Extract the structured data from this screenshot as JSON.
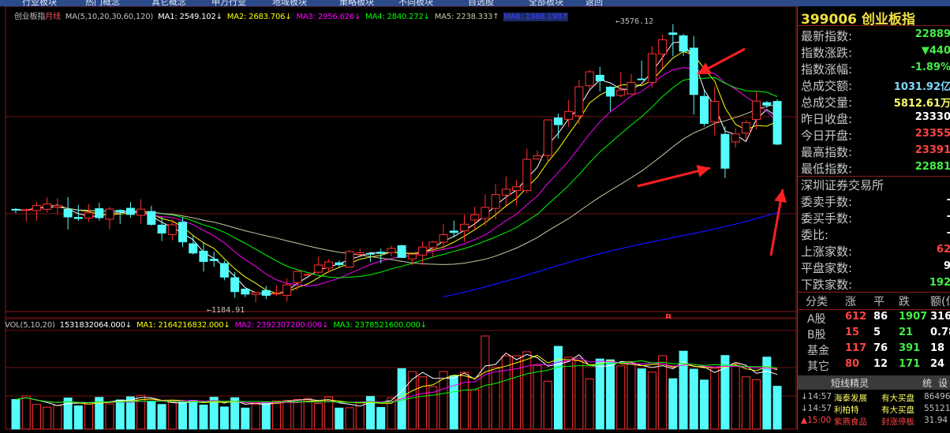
{
  "top_tabs": [
    "行业板块",
    "热门概念",
    "其它概念",
    "申万行业",
    "地域板块",
    "策略板块",
    "不同板块",
    "自选股",
    "全部板块",
    "返回"
  ],
  "main_legend": {
    "name": "创业板指",
    "period": "月线",
    "ma_params": "MA(5,10,20,30,60,120)",
    "ma1": "MA1: 2549.102↓",
    "ma2": "MA2: 2683.706↓",
    "ma3": "MA3: 2956.626↓",
    "ma4": "MA4: 2840.272↓",
    "ma5": "MA5: 2238.333↑",
    "ma6": "MA6: 1986.198↑"
  },
  "high_label": "3576.12",
  "low_label": "1184.91",
  "b_marker": "B",
  "vol_legend": {
    "params": "VOL(5,10,20)",
    "vol": "1531832064.000↓",
    "ma1": "MA1: 2164216832.000↓",
    "ma2": "MA2: 2392307200.000↓",
    "ma3": "MA3: 2378521600.000↓"
  },
  "colors": {
    "up": "#ff3030",
    "down": "#54fcfc",
    "ma1": "#ffffff",
    "ma2": "#ffff00",
    "ma3": "#ff00ff",
    "ma4": "#00ff00",
    "ma5": "#c8c8a0",
    "ma6": "#1010ff",
    "arrow": "#ff2020"
  },
  "panel": {
    "code": "399006",
    "title": "创业板指",
    "rows": [
      {
        "label": "最新指数:",
        "value": "22889",
        "color": "green"
      },
      {
        "label": "指数涨跌:",
        "value": "▼440",
        "color": "green"
      },
      {
        "label": "指数涨幅:",
        "value": "-1.89%",
        "color": "green"
      },
      {
        "label": "总成交额:",
        "value": "1031.92亿",
        "color": "cyan"
      },
      {
        "label": "总成交量:",
        "value": "5812.61万",
        "color": "yellowish"
      },
      {
        "label": "昨日收盘:",
        "value": "23330",
        "color": "white"
      },
      {
        "label": "今日开盘:",
        "value": "23355",
        "color": "red"
      },
      {
        "label": "最高指数:",
        "value": "23391",
        "color": "red"
      },
      {
        "label": "最低指数:",
        "value": "22881",
        "color": "green"
      }
    ],
    "exchange": "深圳证券交易所",
    "rows2": [
      {
        "label": "委卖手数:",
        "value": "-",
        "color": "white"
      },
      {
        "label": "委买手数:",
        "value": "-",
        "color": "white"
      },
      {
        "label": "委比:",
        "value": "-",
        "color": "white"
      },
      {
        "label": "上涨家数:",
        "value": "62",
        "color": "red"
      },
      {
        "label": "平盘家数:",
        "value": "9",
        "color": "white"
      },
      {
        "label": "下跌家数:",
        "value": "192",
        "color": "green"
      }
    ],
    "grid_header": [
      "分类",
      "涨",
      "平",
      "跌",
      "额(亿"
    ],
    "grid": [
      [
        "A股",
        "612",
        "86",
        "1907",
        "316"
      ],
      [
        "B股",
        "15",
        "5",
        "21",
        "0.78"
      ],
      [
        "基金",
        "117",
        "76",
        "391",
        "18"
      ],
      [
        "其它",
        "80",
        "12",
        "171",
        "24"
      ]
    ],
    "tabs": [
      "短线精灵",
      "统",
      "设"
    ],
    "news": [
      {
        "time": "↓14:57",
        "name": "海泰发展",
        "event": "有大买盘",
        "value": "86496"
      },
      {
        "time": "↓14:57",
        "name": "利柏特",
        "event": "有大买盘",
        "value": "55121"
      },
      {
        "time": "▲15:00",
        "name": "紫燕食品",
        "event": "封涨停板",
        "value": "31.94"
      }
    ]
  }
}
